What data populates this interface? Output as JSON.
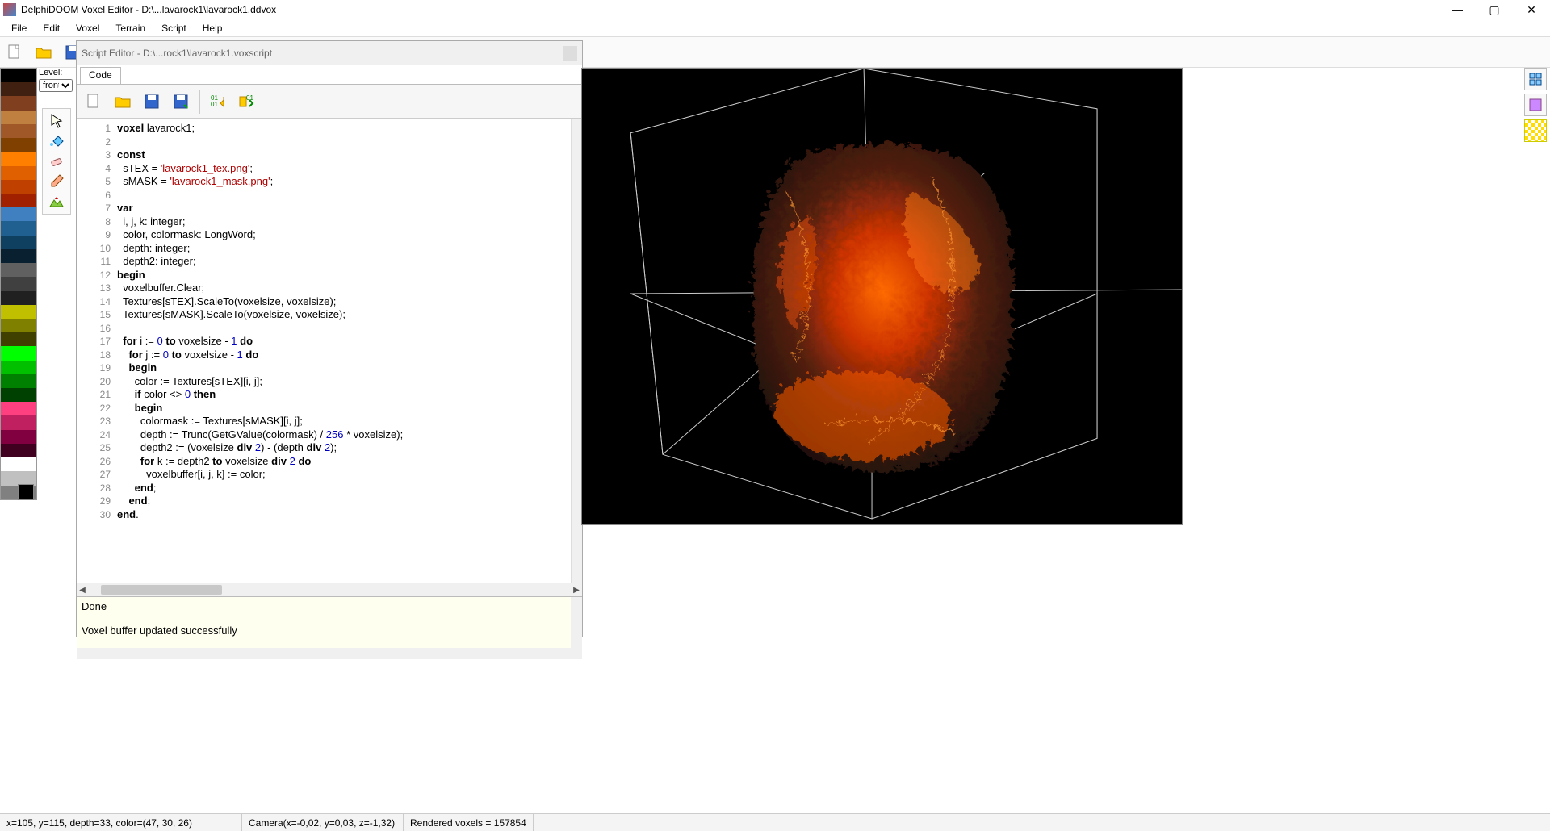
{
  "title": "DelphiDOOM Voxel Editor - D:\\...lavarock1\\lavarock1.ddvox",
  "menu": [
    "File",
    "Edit",
    "Voxel",
    "Terrain",
    "Script",
    "Help"
  ],
  "level_label": "Level:",
  "level_value": "front",
  "script_editor": {
    "title": "Script Editor - D:\\...rock1\\lavarock1.voxscript",
    "tab": "Code",
    "output": [
      "Done",
      "",
      "Voxel buffer updated successfully"
    ]
  },
  "code_lines": [
    {
      "n": 1,
      "html": "<span class='kw'>voxel</span> lavarock1;"
    },
    {
      "n": 2,
      "html": ""
    },
    {
      "n": 3,
      "html": "<span class='kw'>const</span>"
    },
    {
      "n": 4,
      "html": "  sTEX = <span class='str'>'lavarock1_tex.png'</span>;"
    },
    {
      "n": 5,
      "html": "  sMASK = <span class='str'>'lavarock1_mask.png'</span>;"
    },
    {
      "n": 6,
      "html": ""
    },
    {
      "n": 7,
      "html": "<span class='kw'>var</span>"
    },
    {
      "n": 8,
      "html": "  i, j, k: integer;"
    },
    {
      "n": 9,
      "html": "  color, colormask: LongWord;"
    },
    {
      "n": 10,
      "html": "  depth: integer;"
    },
    {
      "n": 11,
      "html": "  depth2: integer;"
    },
    {
      "n": 12,
      "html": "<span class='kw'>begin</span>"
    },
    {
      "n": 13,
      "html": "  voxelbuffer.Clear;"
    },
    {
      "n": 14,
      "html": "  Textures[sTEX].ScaleTo(voxelsize, voxelsize);"
    },
    {
      "n": 15,
      "html": "  Textures[sMASK].ScaleTo(voxelsize, voxelsize);"
    },
    {
      "n": 16,
      "html": ""
    },
    {
      "n": 17,
      "html": "  <span class='kw'>for</span> i := <span class='num'>0</span> <span class='kw'>to</span> voxelsize - <span class='num'>1</span> <span class='kw'>do</span>"
    },
    {
      "n": 18,
      "html": "    <span class='kw'>for</span> j := <span class='num'>0</span> <span class='kw'>to</span> voxelsize - <span class='num'>1</span> <span class='kw'>do</span>"
    },
    {
      "n": 19,
      "html": "    <span class='kw'>begin</span>"
    },
    {
      "n": 20,
      "html": "      color := Textures[sTEX][i, j];"
    },
    {
      "n": 21,
      "html": "      <span class='kw'>if</span> color &lt;&gt; <span class='num'>0</span> <span class='kw'>then</span>"
    },
    {
      "n": 22,
      "html": "      <span class='kw'>begin</span>"
    },
    {
      "n": 23,
      "html": "        colormask := Textures[sMASK][i, j];"
    },
    {
      "n": 24,
      "html": "        depth := Trunc(GetGValue(colormask) / <span class='num'>256</span> * voxelsize);"
    },
    {
      "n": 25,
      "html": "        depth2 := (voxelsize <span class='kw'>div</span> <span class='num'>2</span>) - (depth <span class='kw'>div</span> <span class='num'>2</span>);"
    },
    {
      "n": 26,
      "html": "        <span class='kw'>for</span> k := depth2 <span class='kw'>to</span> voxelsize <span class='kw'>div</span> <span class='num'>2</span> <span class='kw'>do</span>"
    },
    {
      "n": 27,
      "html": "          voxelbuffer[i, j, k] := color;"
    },
    {
      "n": 28,
      "html": "      <span class='kw'>end</span>;"
    },
    {
      "n": 29,
      "html": "    <span class='kw'>end</span>;"
    },
    {
      "n": 30,
      "html": "<span class='kw'>end</span>."
    }
  ],
  "palette_colors": [
    "#000",
    "#402010",
    "#804020",
    "#c08040",
    "#a05828",
    "#804000",
    "#ff8000",
    "#e06000",
    "#c04000",
    "#a02000",
    "#4080c0",
    "#206090",
    "#104060",
    "#082030",
    "#606060",
    "#404040",
    "#202020",
    "#c0c000",
    "#808000",
    "#404000",
    "#00ff00",
    "#00c000",
    "#008000",
    "#004000",
    "#ff4080",
    "#c02060",
    "#800040",
    "#400020",
    "#ffffff",
    "#c0c0c0",
    "#808080"
  ],
  "status": {
    "coords": "x=105, y=115, depth=33, color=(47, 30, 26)",
    "camera": "Camera(x=-0,02, y=0,03, z=-1,32)",
    "voxels": "Rendered voxels = 157854"
  }
}
